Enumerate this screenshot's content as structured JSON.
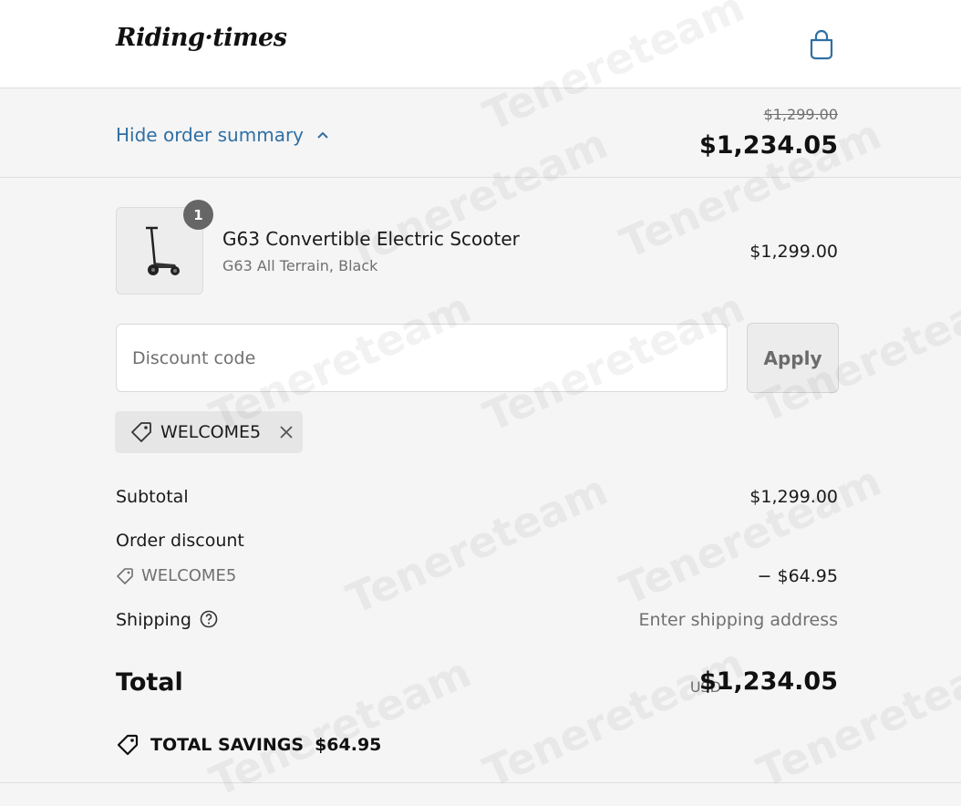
{
  "header": {
    "logo_text": "Riding·times",
    "cart_icon": "shopping-bag-icon"
  },
  "summary_bar": {
    "toggle_label": "Hide order summary",
    "toggle_icon": "chevron-up-icon",
    "original_price": "$1,299.00",
    "total_price": "$1,234.05"
  },
  "line_item": {
    "quantity": "1",
    "name": "G63 Convertible Electric Scooter",
    "variant": "G63 All Terrain, Black",
    "price": "$1,299.00",
    "image_icon": "electric-scooter-icon"
  },
  "discount": {
    "placeholder": "Discount code",
    "value": "",
    "apply_label": "Apply",
    "applied_code": "WELCOME5"
  },
  "totals": {
    "subtotal_label": "Subtotal",
    "subtotal_value": "$1,299.00",
    "order_discount_label": "Order discount",
    "order_discount_code": "WELCOME5",
    "order_discount_value": "− $64.95",
    "shipping_label": "Shipping",
    "shipping_value": "Enter shipping address",
    "total_label": "Total",
    "total_currency": "USD",
    "total_value": "$1,234.05",
    "savings_label": "TOTAL SAVINGS",
    "savings_value": "$64.95"
  },
  "watermark_text": "Tenereteam",
  "colors": {
    "link": "#2f6fa3",
    "background": "#f5f5f5",
    "muted_text": "#707070"
  }
}
